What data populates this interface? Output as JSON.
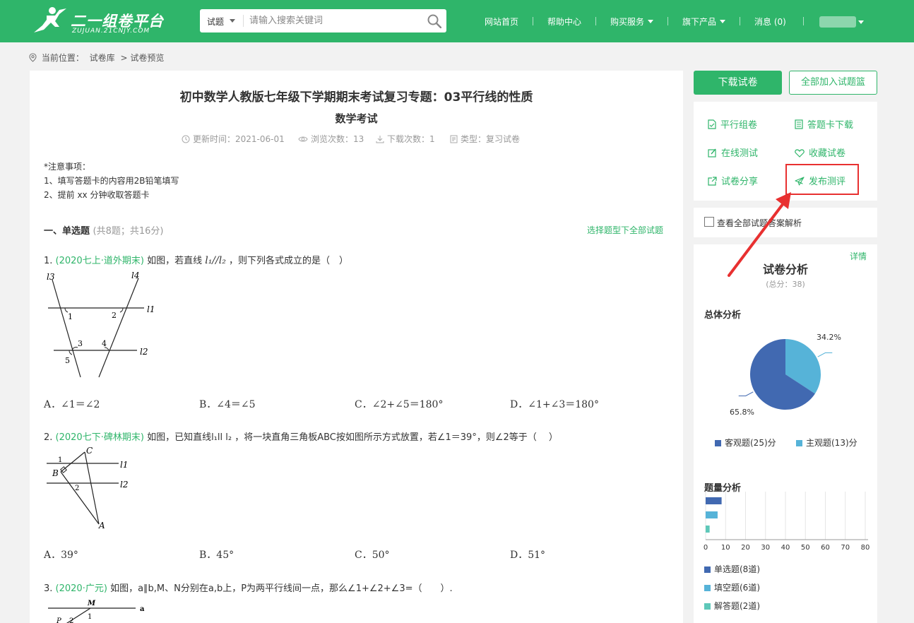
{
  "header": {
    "logo_text": "二一组卷平台",
    "logo_sub": "ZUJUAN.21CNJY.COM",
    "search_type": "试题",
    "search_placeholder": "请输入搜索关键词",
    "nav": [
      "网站首页",
      "帮助中心",
      "购买服务",
      "旗下产品",
      "消息 (0)"
    ],
    "accent_color": "#2fb56a"
  },
  "breadcrumb": {
    "prefix": "当前位置：",
    "items": [
      "试卷库",
      "> 试卷预览"
    ]
  },
  "paper": {
    "title": "初中数学人教版七年级下学期期末考试复习专题：03平行线的性质",
    "subtitle": "数学考试",
    "meta": {
      "updated": "更新时间：2021-06-01",
      "views": "浏览次数：13",
      "downloads": "下载次数：1",
      "type": "类型：复习试卷"
    },
    "notice": [
      "*注意事项：",
      "1、填写答题卡的内容用2B铅笔填写",
      "2、提前 xx 分钟收取答题卡"
    ],
    "section": {
      "title": "一、单选题",
      "sub": "(共8题；共16分)",
      "select_all": "选择题型下全部试题"
    },
    "questions": [
      {
        "num": "1.",
        "source": "(2020七上·道外期末)",
        "text_a": "如图，若直线",
        "math": "l₁//l₂",
        "text_b": "，则下列各式成立的是（　）",
        "options": [
          "A．∠1＝∠2",
          "B．∠4＝∠5",
          "C．∠2+∠5＝180°",
          "D．∠1+∠3＝180°"
        ],
        "fig_labels": [
          "l3",
          "l4",
          "l1",
          "l2",
          "1",
          "2",
          "3",
          "4",
          "5"
        ]
      },
      {
        "num": "2.",
        "source": "(2020七下·碑林期末)",
        "text": "如图，已知直线l₁ll l₂ ，将一块直角三角板ABC按如图所示方式放置，若∠1＝39°，则∠2等于（　 ）",
        "options": [
          "A．39°",
          "B．45°",
          "C．50°",
          "D．51°"
        ],
        "fig_labels": [
          "C",
          "B",
          "A",
          "l1",
          "l2",
          "1",
          "2"
        ]
      },
      {
        "num": "3.",
        "source": "(2020·广元)",
        "text": "如图，a∥b,M、N分别在a,b上，P为两平行线间一点，那么∠1+∠2+∠3=（　　）.",
        "fig_labels": [
          "M",
          "a",
          "P",
          "1",
          "2"
        ]
      }
    ]
  },
  "sidebar": {
    "download_btn": "下载试卷",
    "add_all_btn": "全部加入试题篮",
    "tools": [
      "平行组卷",
      "答题卡下载",
      "在线测试",
      "收藏试卷",
      "试卷分享",
      "发布测评"
    ],
    "view_all": "查看全部试题答案解析",
    "analysis": {
      "title": "试卷分析",
      "total": "(总分：38)",
      "detail": "详情",
      "overall_title": "总体分析",
      "qty_title": "题量分析"
    }
  },
  "chart_data": [
    {
      "type": "pie",
      "title": "总体分析",
      "labels": [
        "客观题(25)分",
        "主观题(13)分"
      ],
      "values": [
        65.8,
        34.2
      ],
      "value_labels": [
        "65.8%",
        "34.2%"
      ],
      "colors": [
        "#4169b1",
        "#56b3d8"
      ]
    },
    {
      "type": "bar",
      "title": "题量分析",
      "categories": [
        "单选题(8道)",
        "填空题(6道)",
        "解答题(2道)"
      ],
      "values": [
        8,
        6,
        2
      ],
      "xlim": [
        0,
        80
      ],
      "x_ticks": [
        "0",
        "10",
        "20",
        "30",
        "40",
        "50",
        "60",
        "70",
        "80"
      ],
      "colors": [
        "#4169b1",
        "#56b3d8",
        "#5ec8b9"
      ]
    }
  ]
}
